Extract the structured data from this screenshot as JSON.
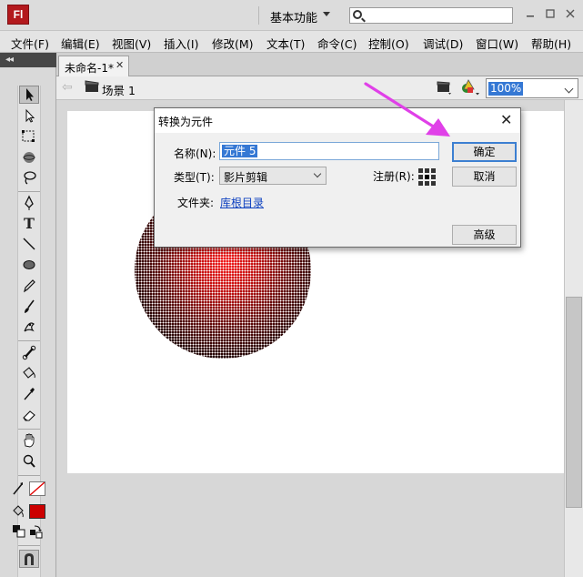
{
  "app": {
    "logo_text": "Fl",
    "workspace": "基本功能",
    "search": {
      "value": ""
    }
  },
  "menu": [
    "文件(F)",
    "编辑(E)",
    "视图(V)",
    "插入(I)",
    "修改(M)",
    "文本(T)",
    "命令(C)",
    "控制(O)",
    "调试(D)",
    "窗口(W)",
    "帮助(H)"
  ],
  "document": {
    "tab_label": "未命名-1*",
    "tab_close": "✕",
    "scene_label": "场景 1",
    "zoom": "100%"
  },
  "tools_panel": {
    "collapse_glyph": "◂◂",
    "tools": [
      "selection-tool",
      "subselection-tool",
      "free-transform-tool",
      "3d-rotation-tool",
      "lasso-tool",
      "pen-tool",
      "text-tool",
      "line-tool",
      "oval-tool",
      "pencil-tool",
      "brush-tool",
      "deco-tool",
      "bone-tool",
      "paint-bucket-tool",
      "eyedropper-tool",
      "eraser-tool",
      "hand-tool",
      "zoom-tool"
    ],
    "text_tool_glyph": "T",
    "stroke_color": "none",
    "fill_color": "#cc0000"
  },
  "dialog": {
    "title": "转换为元件",
    "close": "✕",
    "name_label": "名称(N):",
    "name_value": "元件 5",
    "type_label": "类型(T):",
    "type_value": "影片剪辑",
    "registration_label": "注册(R):",
    "folder_label": "文件夹:",
    "folder_link": "库根目录",
    "ok_button": "确定",
    "cancel_button": "取消",
    "advanced_button": "高级"
  },
  "colors": {
    "annotation_arrow": "#e040e8",
    "selection_blue": "#3578d4",
    "circle_red": "#e01010"
  }
}
